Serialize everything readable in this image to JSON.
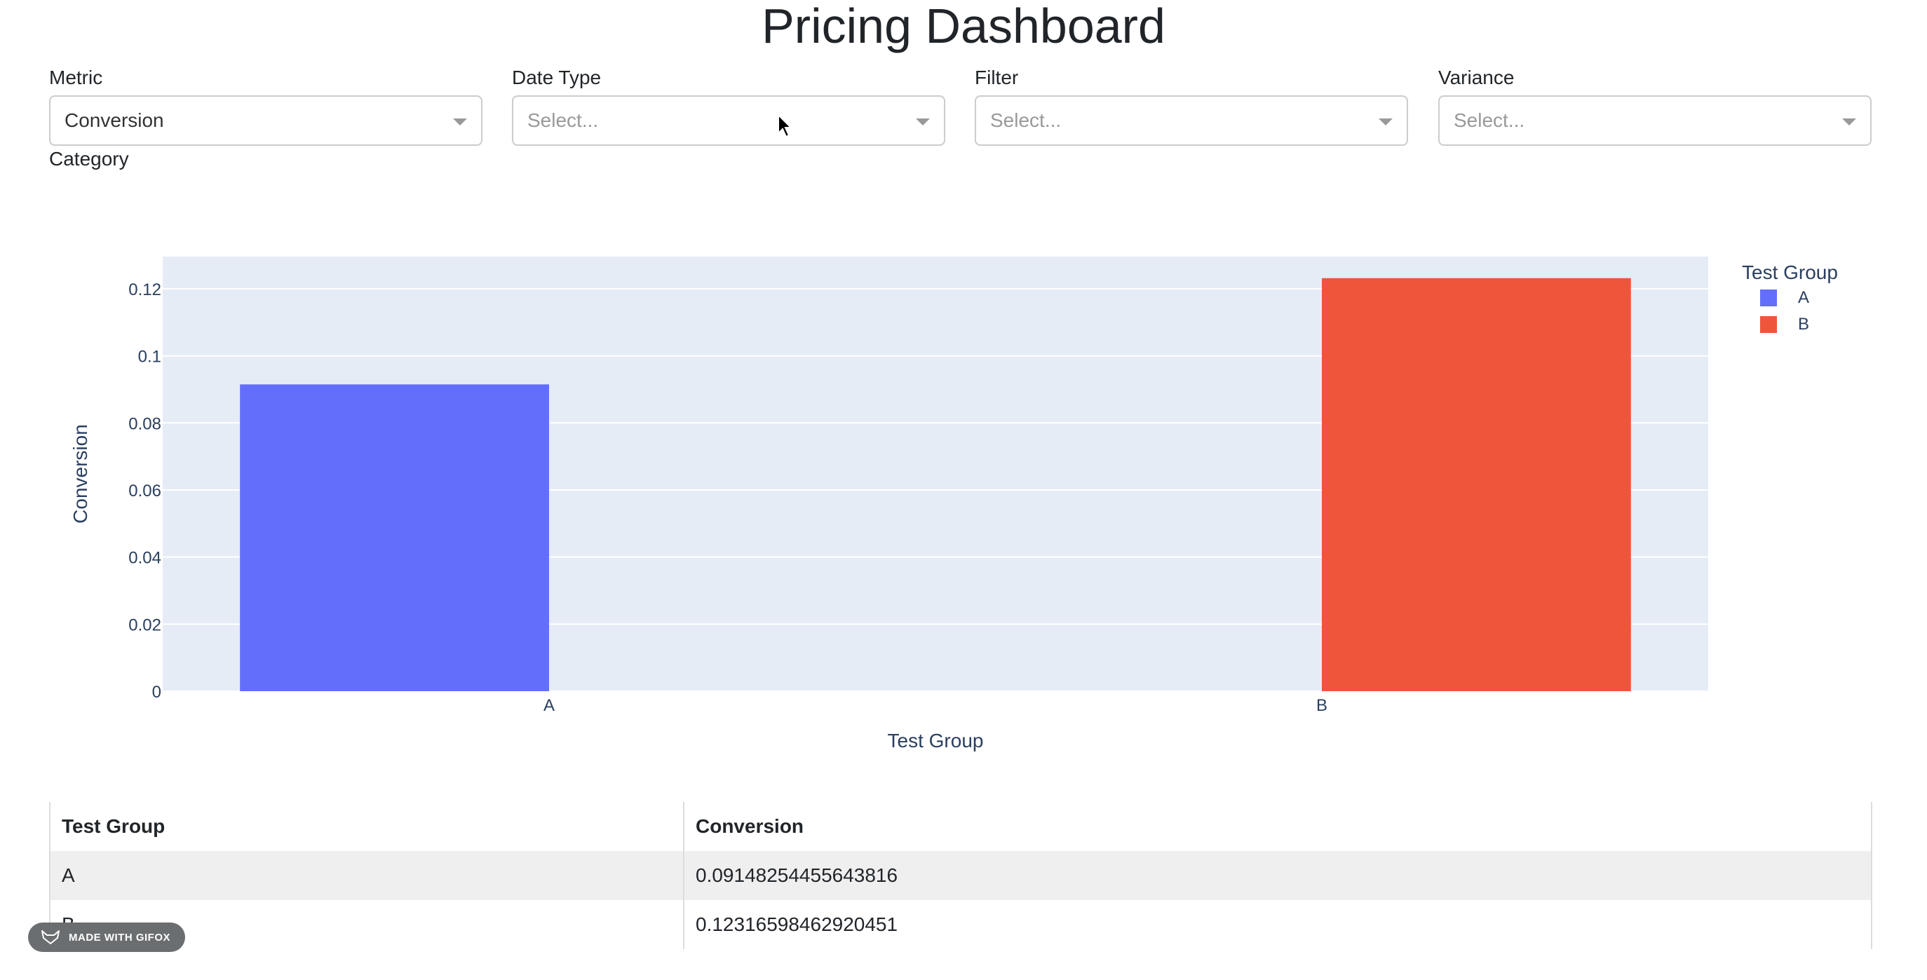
{
  "page_title": "Pricing Dashboard",
  "controls": [
    {
      "label": "Metric",
      "value": "Conversion",
      "placeholder": false
    },
    {
      "label": "Date Type",
      "value": "Select...",
      "placeholder": true
    },
    {
      "label": "Filter",
      "value": "Select...",
      "placeholder": true
    },
    {
      "label": "Variance",
      "value": "Select...",
      "placeholder": true
    }
  ],
  "category_label": "Category",
  "chart_data": {
    "type": "bar",
    "categories": [
      "A",
      "B"
    ],
    "values": [
      0.09148254455643816,
      0.12316598462920451
    ],
    "colors": [
      "#636efa",
      "#ef553b"
    ],
    "xlabel": "Test Group",
    "ylabel": "Conversion",
    "ylim": [
      0,
      0.1296
    ],
    "yticks": [
      0,
      0.02,
      0.04,
      0.06,
      0.08,
      0.1,
      0.12
    ],
    "ytick_labels": [
      "0",
      "0.02",
      "0.04",
      "0.06",
      "0.08",
      "0.1",
      "0.12"
    ],
    "legend": {
      "title": "Test Group",
      "entries": [
        "A",
        "B"
      ],
      "position": "right"
    },
    "plot_bgcolor": "#e5ecf6",
    "grid": true
  },
  "table": {
    "headers": [
      "Test Group",
      "Conversion"
    ],
    "rows": [
      [
        "A",
        "0.09148254455643816"
      ],
      [
        "B",
        "0.12316598462920451"
      ]
    ]
  },
  "badge_text": "MADE WITH GIFOX"
}
